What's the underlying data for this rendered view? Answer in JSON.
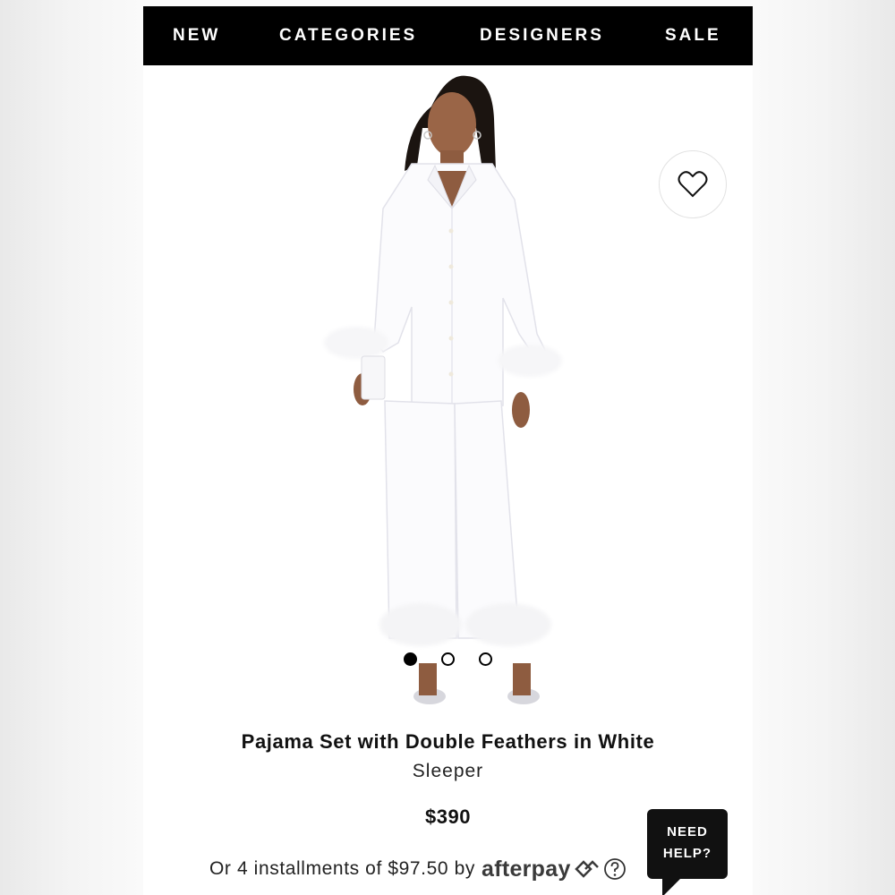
{
  "nav": {
    "items": [
      "NEW",
      "CATEGORIES",
      "DESIGNERS",
      "SALE"
    ]
  },
  "gallery": {
    "slide_count": 3,
    "active_slide": 1
  },
  "product": {
    "title": "Pajama Set with Double Feathers in White",
    "brand": "Sleeper",
    "price": "$390",
    "installments_text": "Or 4 installments of $97.50 by",
    "payment_provider": "afterpay"
  },
  "help": {
    "line1": "NEED",
    "line2": "HELP?"
  },
  "icons": {
    "wishlist": "heart-icon",
    "afterpay_badge": "afterpay-arrows-icon",
    "info": "question-mark-icon"
  },
  "colors": {
    "nav_background": "#000000",
    "page_background": "#ffffff",
    "garment": "#fbfbfd"
  }
}
